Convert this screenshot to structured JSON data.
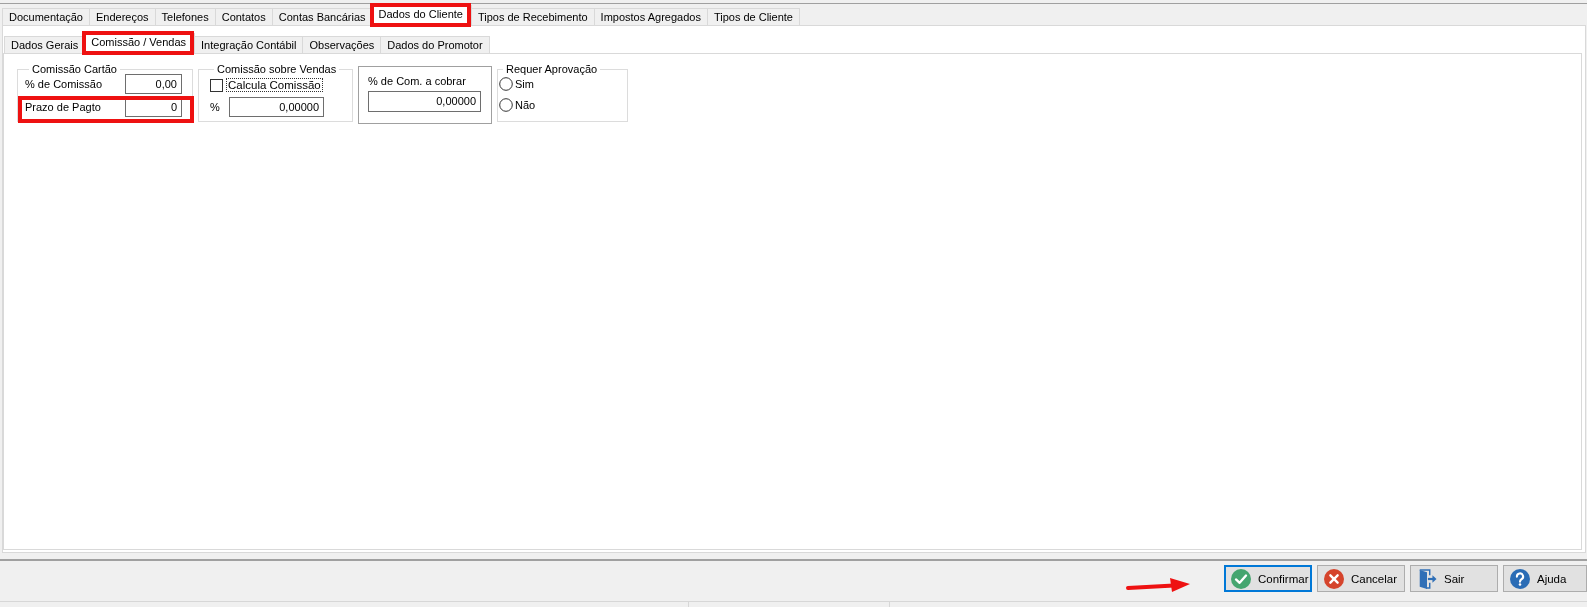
{
  "outer_tabs": [
    {
      "label": "Documentação",
      "selected": false,
      "highlighted": false
    },
    {
      "label": "Endereços",
      "selected": false,
      "highlighted": false
    },
    {
      "label": "Telefones",
      "selected": false,
      "highlighted": false
    },
    {
      "label": "Contatos",
      "selected": false,
      "highlighted": false
    },
    {
      "label": "Contas Bancárias",
      "selected": false,
      "highlighted": false
    },
    {
      "label": "Dados do Cliente",
      "selected": true,
      "highlighted": true
    },
    {
      "label": "Tipos de Recebimento",
      "selected": false,
      "highlighted": false
    },
    {
      "label": "Impostos Agregados",
      "selected": false,
      "highlighted": false
    },
    {
      "label": "Tipos de Cliente",
      "selected": false,
      "highlighted": false
    }
  ],
  "inner_tabs": [
    {
      "label": "Dados Gerais",
      "selected": false,
      "highlighted": false
    },
    {
      "label": "Comissão / Vendas",
      "selected": true,
      "highlighted": true
    },
    {
      "label": "Integração Contábil",
      "selected": false,
      "highlighted": false
    },
    {
      "label": "Observações",
      "selected": false,
      "highlighted": false
    },
    {
      "label": "Dados do Promotor",
      "selected": false,
      "highlighted": false
    }
  ],
  "card_commission": {
    "title": "Comissão Cartão",
    "fields": [
      {
        "label": "% de Comissão",
        "value": "0,00",
        "highlighted": false
      },
      {
        "label": "Prazo de Pagto",
        "value": "0",
        "highlighted": true
      }
    ]
  },
  "sales_commission": {
    "title": "Comissão sobre Vendas",
    "checkbox": {
      "label": "Calcula Comissão",
      "checked": false,
      "focused": true
    },
    "percent_label": "%",
    "value": "0,00000"
  },
  "commission_to_charge": {
    "label": "% de Com. a cobrar",
    "value": "0,00000"
  },
  "approval": {
    "title": "Requer Aprovação",
    "options": [
      {
        "label": "Sim",
        "selected": false
      },
      {
        "label": "Não",
        "selected": false
      }
    ]
  },
  "buttons": [
    {
      "kind": "confirm",
      "label": "Confirmar",
      "focused": true,
      "pointed": true
    },
    {
      "kind": "cancel",
      "label": "Cancelar",
      "focused": false,
      "pointed": false
    },
    {
      "kind": "exit",
      "label": "Sair",
      "focused": false,
      "pointed": false
    },
    {
      "kind": "help",
      "label": "Ajuda",
      "focused": false,
      "pointed": false
    }
  ]
}
